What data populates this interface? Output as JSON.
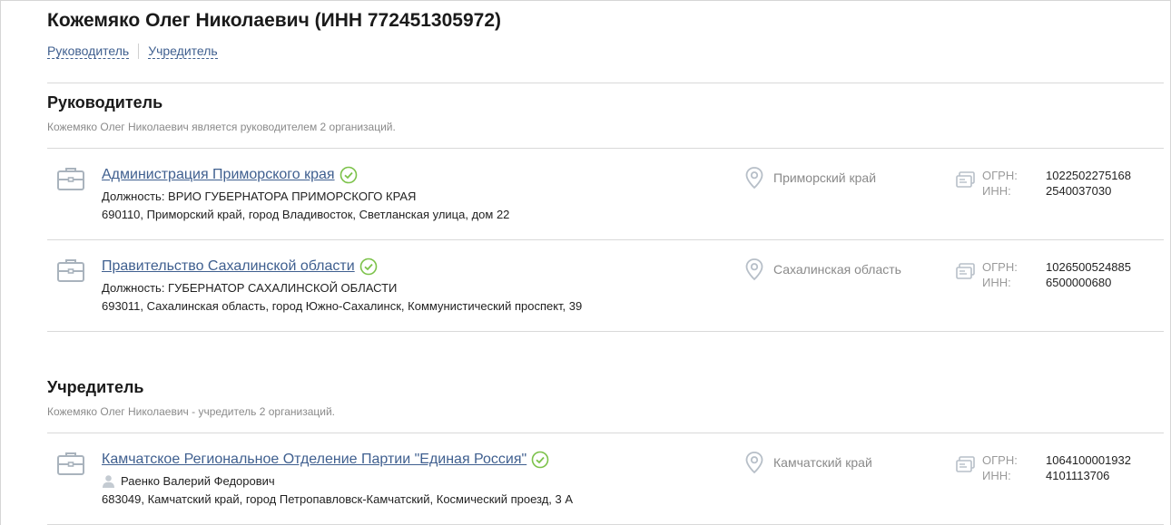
{
  "page_title": "Кожемяко Олег Николаевич (ИНН 772451305972)",
  "tabs": [
    {
      "label": "Руководитель"
    },
    {
      "label": "Учредитель"
    }
  ],
  "sections": {
    "director": {
      "title": "Руководитель",
      "subtitle": "Кожемяко Олег Николаевич является руководителем 2 организаций.",
      "rows": [
        {
          "name": "Администрация Приморского края",
          "meta": "Должность: ВРИО ГУБЕРНАТОРА ПРИМОРСКОГО КРАЯ",
          "address": "690110, Приморский край, город Владивосток, Светланская улица, дом 22",
          "region": "Приморский край",
          "ogrn_label": "ОГРН:",
          "inn_label": "ИНН:",
          "ogrn": "1022502275168",
          "inn": "2540037030"
        },
        {
          "name": "Правительство Сахалинской области",
          "meta": "Должность: ГУБЕРНАТОР САХАЛИНСКОЙ ОБЛАСТИ",
          "address": "693011, Сахалинская область, город Южно-Сахалинск, Коммунистический проспект, 39",
          "region": "Сахалинская область",
          "ogrn_label": "ОГРН:",
          "inn_label": "ИНН:",
          "ogrn": "1026500524885",
          "inn": "6500000680"
        }
      ]
    },
    "founder": {
      "title": "Учредитель",
      "subtitle": "Кожемяко Олег Николаевич - учредитель 2 организаций.",
      "rows": [
        {
          "name": "Камчатское Региональное Отделение Партии \"Единая Россия\"",
          "person": "Раенко Валерий Федорович",
          "address": "683049, Камчатский край, город Петропавловск-Камчатский, Космический проезд, 3 А",
          "region": "Камчатский край",
          "ogrn_label": "ОГРН:",
          "inn_label": "ИНН:",
          "ogrn": "1064100001932",
          "inn": "4101113706"
        }
      ]
    }
  },
  "colors": {
    "link": "#3f5f8f",
    "verified_green": "#7cc24a",
    "muted_text": "#8a8a8a",
    "divider": "#d9d9d9",
    "icon_gray": "#a9b3bd"
  },
  "icons": {
    "org": "briefcase-icon",
    "verified": "check-circle-icon",
    "region": "map-pin-icon",
    "ids": "id-card-icon",
    "person": "person-icon"
  }
}
